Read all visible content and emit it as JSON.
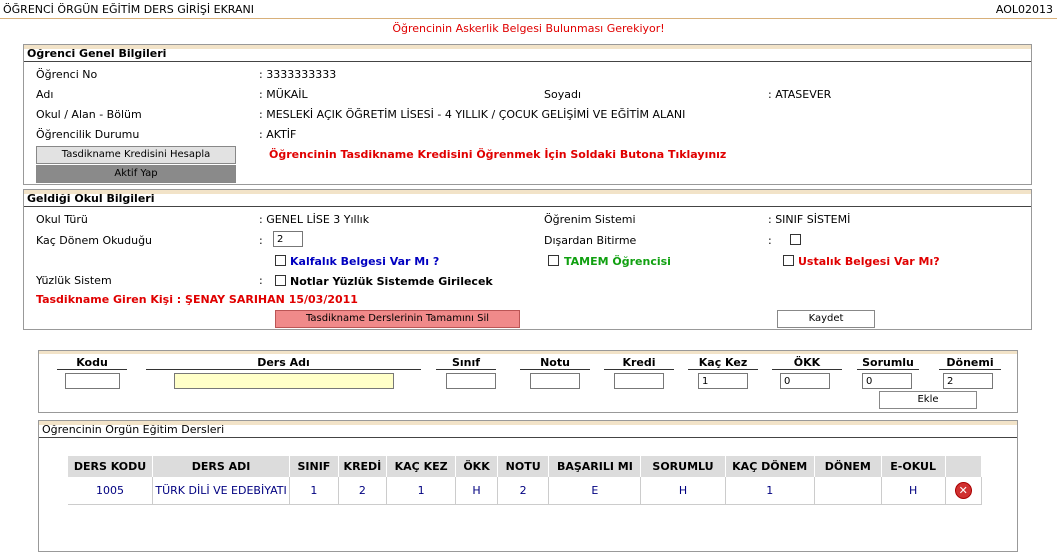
{
  "header": {
    "title": "ÖĞRENCİ ÖRGÜN EĞİTİM DERS GİRİŞİ EKRANI",
    "code": "AOL02013"
  },
  "warning": "Öğrencinin Askerlik Belgesi Bulunması Gerekiyor!",
  "student": {
    "section_title": "Öğrenci Genel Bilgileri",
    "no_label": "Öğrenci No",
    "no_value": ": 3333333333",
    "name_label": "Adı",
    "name_value": ": MÜKAİL",
    "surname_label": "Soyadı",
    "surname_value": ": ATASEVER",
    "school_label": "Okul / Alan - Bölüm",
    "school_value": ": MESLEKİ AÇIK ÖĞRETİM LİSESİ - 4 YILLIK / ÇOCUK GELİŞİMİ VE EĞİTİM ALANI",
    "status_label": "Öğrencilik Durumu",
    "status_value": ": AKTİF",
    "credit_button": "Tasdikname Kredisini Hesapla",
    "active_button": "Aktif Yap",
    "credit_hint": "Öğrencinin Tasdikname Kredisini Öğrenmek İçin Soldaki Butona Tıklayınız"
  },
  "school": {
    "section_title": "Geldiği Okul Bilgileri",
    "type_label": "Okul Türü",
    "type_value": ": GENEL LİSE 3 Yıllık",
    "system_label": "Öğrenim Sistemi",
    "system_value": ": SINIF SİSTEMİ",
    "terms_label": "Kaç Dönem Okuduğu",
    "terms_colon": ":",
    "terms_value": "2",
    "external_label": "Dışardan Bitirme",
    "external_colon": ":",
    "kalfalik_label": "Kalfalık Belgesi Var Mı ?",
    "tamem_label": "TAMEM Öğrencisi",
    "ustalik_label": "Ustalık Belgesi Var Mı?",
    "percent_label": "Yüzlük Sistem",
    "percent_colon": ":",
    "percent_check_label": "Notlar Yüzlük Sistemde Girilecek",
    "entered_by": "Tasdikname Giren Kişi : ŞENAY SARIHAN 15/03/2011",
    "delete_all_button": "Tasdikname Derslerinin Tamamını Sil",
    "save_button": "Kaydet"
  },
  "entry": {
    "headers": {
      "kodu": "Kodu",
      "ders_adi": "Ders Adı",
      "sinif": "Sınıf",
      "notu": "Notu",
      "kredi": "Kredi",
      "kac_kez": "Kaç Kez",
      "okk": "ÖKK",
      "sorumlu": "Sorumlu",
      "donemi": "Dönemi"
    },
    "values": {
      "kodu": "",
      "ders_adi": "",
      "sinif": "",
      "notu": "",
      "kredi": "",
      "kac_kez": "1",
      "okk": "0",
      "sorumlu": "0",
      "donemi": "2"
    },
    "add_button": "Ekle"
  },
  "courses": {
    "section_title": "Öğrencinin Örgün Eğitim Dersleri",
    "columns": [
      "DERS KODU",
      "DERS ADI",
      "SINIF",
      "KREDİ",
      "KAÇ KEZ",
      "ÖKK",
      "NOTU",
      "BAŞARILI MI",
      "SORUMLU",
      "KAÇ DÖNEM",
      "DÖNEM",
      "E-OKUL"
    ],
    "rows": [
      [
        "1005",
        "TÜRK DİLİ VE EDEBİYATI",
        "1",
        "2",
        "1",
        "H",
        "2",
        "E",
        "H",
        "1",
        "",
        "H"
      ]
    ]
  }
}
